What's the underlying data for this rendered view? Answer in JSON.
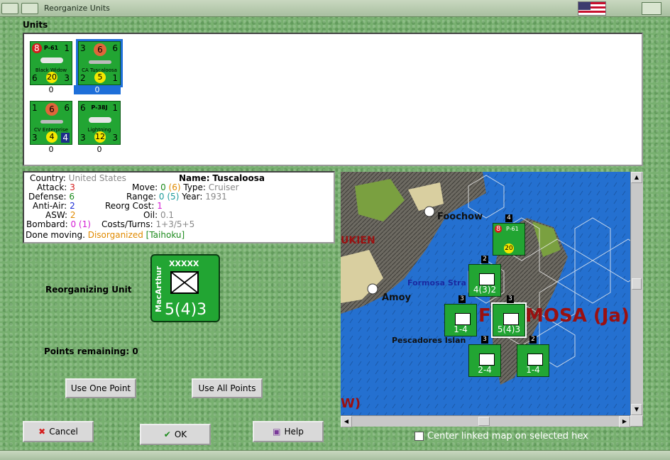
{
  "window": {
    "title": "Reorganize Units"
  },
  "units_label": "Units",
  "units": [
    {
      "type": "P-61",
      "name": "Black Widow",
      "tl": "8",
      "tr": "1",
      "bl": "6",
      "bc": "20",
      "br": "3",
      "count": "0",
      "selected": false
    },
    {
      "type": "",
      "name": "CA Tuscaloosa",
      "tl": "3",
      "tr": "6",
      "circ": "6",
      "bl": "2",
      "bc": "5",
      "br": "1",
      "count": "0",
      "selected": true
    },
    {
      "type": "",
      "name": "CV Enterprise",
      "tl": "1",
      "tr": "6",
      "circ": "6",
      "bl": "3",
      "bc": "4",
      "br": "4",
      "count": "0",
      "selected": false
    },
    {
      "type": "P-38J",
      "name": "Lightning",
      "tl": "6",
      "tr": "1",
      "bl": "3",
      "bc": "12",
      "br": "3",
      "count": "0",
      "selected": false
    }
  ],
  "info": {
    "country_label": "Country:",
    "country": "United States",
    "attack_label": "Attack:",
    "attack": "3",
    "defense_label": "Defense:",
    "defense": "6",
    "antiair_label": "Anti-Air:",
    "antiair": "2",
    "asw_label": "ASW:",
    "asw": "2",
    "bombard_label": "Bombard:",
    "bombard_a": "0",
    "bombard_b": "(1)",
    "done": "Done moving.",
    "disorganized": "Disorganized",
    "location": "[Taihoku]",
    "name_label": "Name:",
    "name": "Tuscaloosa",
    "move_label": "Move:",
    "move_a": "0",
    "move_b": "(6)",
    "type_label": "Type:",
    "type": "Cruiser",
    "range_label": "Range:",
    "range_a": "0",
    "range_b": "(5)",
    "year_label": "Year:",
    "year": "1931",
    "reorg_label": "Reorg Cost:",
    "reorg": "1",
    "oil_label": "Oil:",
    "oil": "0.1",
    "costs_label": "Costs/Turns:",
    "costs": "1+3/5+5"
  },
  "reorganizing": {
    "label": "Reorganizing Unit",
    "counter_name": "MacArthur",
    "counter_size": "XXXXX",
    "counter_value": "5(4)3"
  },
  "points": {
    "label": "Points remaining:",
    "value": "0"
  },
  "buttons": {
    "use_one": "Use One Point",
    "use_all": "Use All Points",
    "cancel": "Cancel",
    "ok": "OK",
    "help": "Help"
  },
  "map": {
    "labels": {
      "foochow": "Foochow",
      "fukien": "UKIEN",
      "formosa_strait": "Formosa Stra",
      "amoy": "Amoy",
      "formosa": "MOSA (Ja)",
      "formosa_f": "F",
      "pescadores": "Pescadores Islan",
      "w": "W)"
    },
    "counters": [
      {
        "value": "4(3)2",
        "badge": "2"
      },
      {
        "value": "1-4",
        "badge": "3"
      },
      {
        "value": "5(4)3",
        "badge": "3"
      },
      {
        "value": "2-4",
        "badge": "3"
      },
      {
        "value": "1-4",
        "badge": "2"
      }
    ],
    "top_unit": {
      "type": "P-61",
      "tl": "8",
      "bc": "20",
      "badge": "4"
    }
  },
  "checkbox": {
    "label": "Center linked map on selected hex",
    "checked": false
  },
  "colors": {
    "counter_green": "#22a533",
    "selection_blue": "#1e6fd9",
    "sea_blue": "#2470d0",
    "formosa_label": "#9a1010"
  }
}
